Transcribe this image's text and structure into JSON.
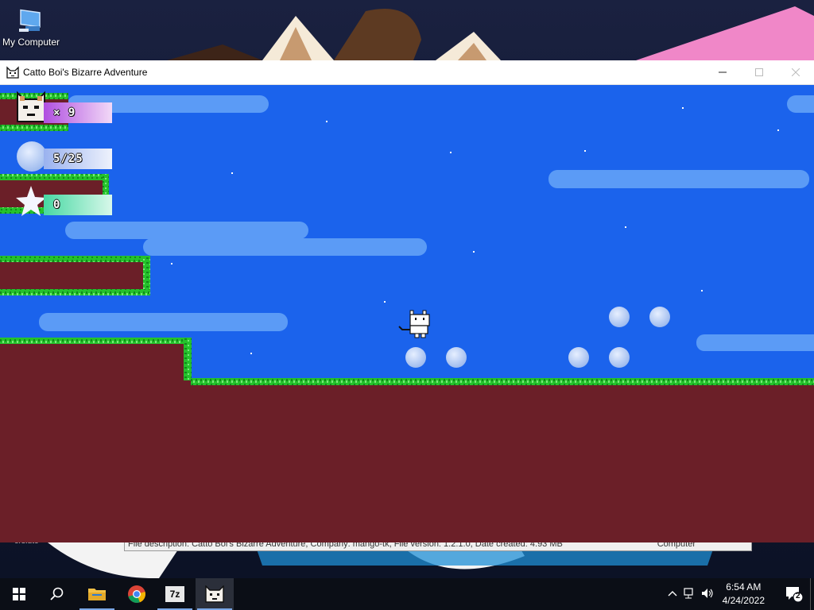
{
  "desktop": {
    "icons": [
      {
        "label": "My Computer",
        "icon": "computer-icon"
      }
    ],
    "hidden_strip_text": "File description: Catto Boi's Bizarre Adventure, Company: mango-tk, File version: 1.2.1.0, Date created: 4.93 MB",
    "hidden_strip_right": "Computer",
    "bottom_left_fragment": "ers.uto"
  },
  "window": {
    "title": "Catto Boi's Bizarre Adventure",
    "app_icon": "cat-icon",
    "controls": [
      "minimize-icon",
      "maximize-icon",
      "close-icon"
    ]
  },
  "hud": {
    "lives": "× 9",
    "orbs": "5/25",
    "stars": "0"
  },
  "colors": {
    "sky": "#1b63ec",
    "ground": "#6b1f28",
    "grass": "#25c22c",
    "orb": "#bcd1f4",
    "cloud": "#5b9bf6"
  },
  "taskbar": {
    "items": [
      {
        "name": "start-button",
        "icon": "windows-logo-icon"
      },
      {
        "name": "search-button",
        "icon": "search-icon"
      },
      {
        "name": "file-explorer",
        "icon": "folder-icon"
      },
      {
        "name": "chrome",
        "icon": "chrome-icon"
      },
      {
        "name": "7zip",
        "icon": "7zip-icon",
        "label": "7z"
      },
      {
        "name": "catto-game",
        "icon": "cat-icon",
        "active": true
      }
    ],
    "time": "6:54 AM",
    "date": "4/24/2022",
    "notification_count": "2"
  }
}
